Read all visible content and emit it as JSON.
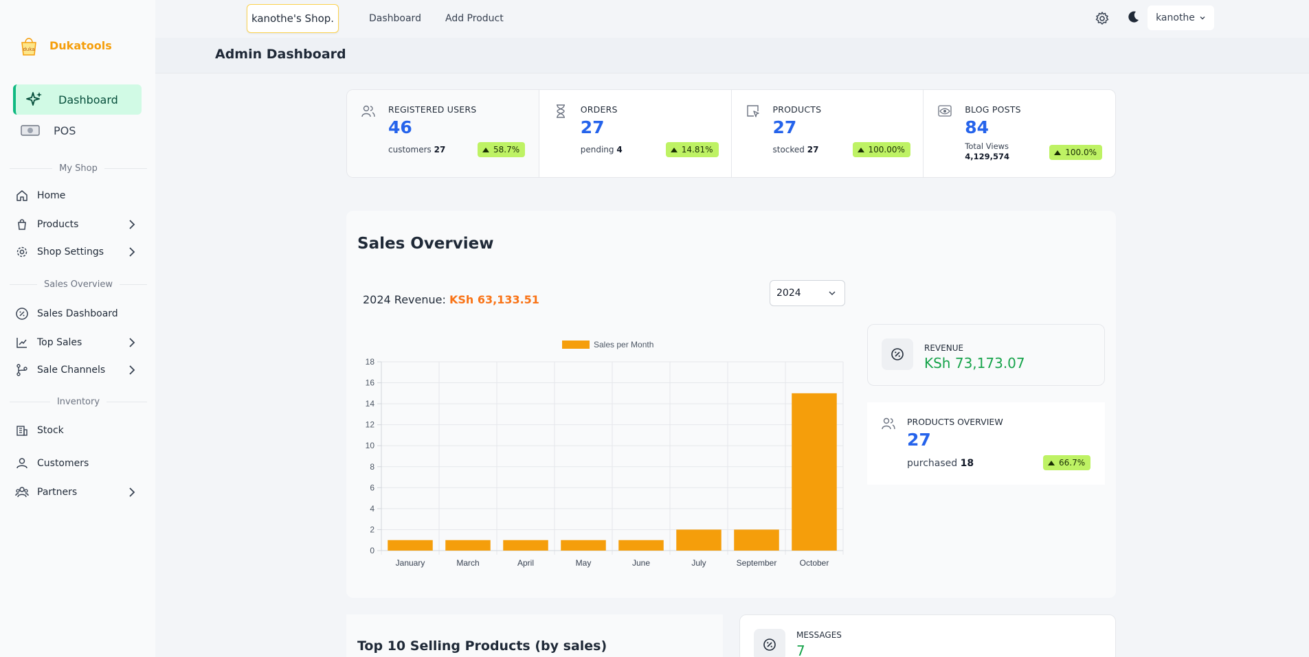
{
  "brand": {
    "name": "Dukatools",
    "logo_text": "duka"
  },
  "sidebar": {
    "dashboard_label": "Dashboard",
    "pos_label": "POS",
    "sections": [
      "My Shop",
      "Sales Overview",
      "Inventory"
    ],
    "items": [
      {
        "label": "Home",
        "icon": "home-icon"
      },
      {
        "label": "Products",
        "icon": "bag-icon"
      },
      {
        "label": "Shop Settings",
        "icon": "gear-icon"
      },
      {
        "label": "Sales Dashboard",
        "icon": "percent-badge-icon"
      },
      {
        "label": "Top Sales",
        "icon": "trend-chart-icon"
      },
      {
        "label": "Sale Channels",
        "icon": "branch-icon"
      },
      {
        "label": "Stock",
        "icon": "building-icon"
      },
      {
        "label": "Customers",
        "icon": "user-icon"
      },
      {
        "label": "Partners",
        "icon": "users-group-icon"
      }
    ]
  },
  "topbar": {
    "shop_button": "kanothe's Shop.",
    "links": [
      "Dashboard",
      "Add Product"
    ],
    "user": "kanothe"
  },
  "page": {
    "title": "Admin Dashboard"
  },
  "stats": [
    {
      "title": "REGISTERED USERS",
      "value": "46",
      "sub_label": "customers",
      "sub_value": "27",
      "change": "58.7%"
    },
    {
      "title": "ORDERS",
      "value": "27",
      "sub_label": "pending",
      "sub_value": "4",
      "change": "14.81%"
    },
    {
      "title": "PRODUCTS",
      "value": "27",
      "sub_label": "stocked",
      "sub_value": "27",
      "change": "100.00%"
    },
    {
      "title": "BLOG POSTS",
      "value": "84",
      "sub_label": "Total Views",
      "sub_value": "4,129,574",
      "change": "100.0%"
    }
  ],
  "sales": {
    "title": "Sales Overview",
    "revenue_label": "2024 Revenue:",
    "revenue_amount": "KSh 63,133.51",
    "year": "2024",
    "revenue_card": {
      "title": "REVENUE",
      "value": "KSh 73,173.07"
    },
    "products_overview": {
      "title": "PRODUCTS OVERVIEW",
      "value": "27",
      "sub_label": "purchased",
      "sub_value": "18",
      "change": "66.7%"
    }
  },
  "chart_data": {
    "type": "bar",
    "categories": [
      "January",
      "March",
      "April",
      "May",
      "June",
      "July",
      "September",
      "October"
    ],
    "series": [
      {
        "name": "Sales per Month",
        "values": [
          1,
          1,
          1,
          1,
          1,
          2,
          2,
          15
        ]
      }
    ],
    "ylim": [
      0,
      18
    ],
    "yticks": [
      0,
      2,
      4,
      6,
      8,
      10,
      12,
      14,
      16,
      18
    ],
    "legend": "top-center",
    "grid": true,
    "bar_color": "#f59e0b"
  },
  "bottom": {
    "top_selling_title": "Top 10 Selling Products (by sales)",
    "messages": {
      "title": "MESSAGES",
      "value": "7"
    }
  },
  "colors": {
    "accent": "#f59e0b",
    "blue": "#2563eb",
    "green": "#16a34a",
    "badge": "#bef264"
  }
}
